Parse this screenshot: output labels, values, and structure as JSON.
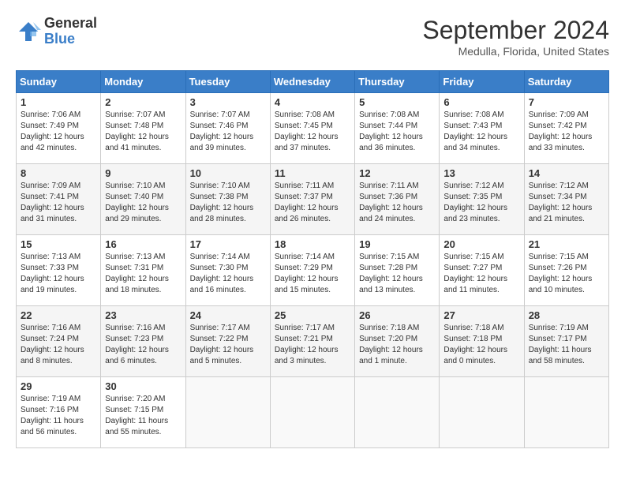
{
  "logo": {
    "general": "General",
    "blue": "Blue"
  },
  "title": "September 2024",
  "location": "Medulla, Florida, United States",
  "days_of_week": [
    "Sunday",
    "Monday",
    "Tuesday",
    "Wednesday",
    "Thursday",
    "Friday",
    "Saturday"
  ],
  "weeks": [
    [
      {
        "day": "1",
        "sunrise": "7:06 AM",
        "sunset": "7:49 PM",
        "daylight": "12 hours and 42 minutes."
      },
      {
        "day": "2",
        "sunrise": "7:07 AM",
        "sunset": "7:48 PM",
        "daylight": "12 hours and 41 minutes."
      },
      {
        "day": "3",
        "sunrise": "7:07 AM",
        "sunset": "7:46 PM",
        "daylight": "12 hours and 39 minutes."
      },
      {
        "day": "4",
        "sunrise": "7:08 AM",
        "sunset": "7:45 PM",
        "daylight": "12 hours and 37 minutes."
      },
      {
        "day": "5",
        "sunrise": "7:08 AM",
        "sunset": "7:44 PM",
        "daylight": "12 hours and 36 minutes."
      },
      {
        "day": "6",
        "sunrise": "7:08 AM",
        "sunset": "7:43 PM",
        "daylight": "12 hours and 34 minutes."
      },
      {
        "day": "7",
        "sunrise": "7:09 AM",
        "sunset": "7:42 PM",
        "daylight": "12 hours and 33 minutes."
      }
    ],
    [
      {
        "day": "8",
        "sunrise": "7:09 AM",
        "sunset": "7:41 PM",
        "daylight": "12 hours and 31 minutes."
      },
      {
        "day": "9",
        "sunrise": "7:10 AM",
        "sunset": "7:40 PM",
        "daylight": "12 hours and 29 minutes."
      },
      {
        "day": "10",
        "sunrise": "7:10 AM",
        "sunset": "7:38 PM",
        "daylight": "12 hours and 28 minutes."
      },
      {
        "day": "11",
        "sunrise": "7:11 AM",
        "sunset": "7:37 PM",
        "daylight": "12 hours and 26 minutes."
      },
      {
        "day": "12",
        "sunrise": "7:11 AM",
        "sunset": "7:36 PM",
        "daylight": "12 hours and 24 minutes."
      },
      {
        "day": "13",
        "sunrise": "7:12 AM",
        "sunset": "7:35 PM",
        "daylight": "12 hours and 23 minutes."
      },
      {
        "day": "14",
        "sunrise": "7:12 AM",
        "sunset": "7:34 PM",
        "daylight": "12 hours and 21 minutes."
      }
    ],
    [
      {
        "day": "15",
        "sunrise": "7:13 AM",
        "sunset": "7:33 PM",
        "daylight": "12 hours and 19 minutes."
      },
      {
        "day": "16",
        "sunrise": "7:13 AM",
        "sunset": "7:31 PM",
        "daylight": "12 hours and 18 minutes."
      },
      {
        "day": "17",
        "sunrise": "7:14 AM",
        "sunset": "7:30 PM",
        "daylight": "12 hours and 16 minutes."
      },
      {
        "day": "18",
        "sunrise": "7:14 AM",
        "sunset": "7:29 PM",
        "daylight": "12 hours and 15 minutes."
      },
      {
        "day": "19",
        "sunrise": "7:15 AM",
        "sunset": "7:28 PM",
        "daylight": "12 hours and 13 minutes."
      },
      {
        "day": "20",
        "sunrise": "7:15 AM",
        "sunset": "7:27 PM",
        "daylight": "12 hours and 11 minutes."
      },
      {
        "day": "21",
        "sunrise": "7:15 AM",
        "sunset": "7:26 PM",
        "daylight": "12 hours and 10 minutes."
      }
    ],
    [
      {
        "day": "22",
        "sunrise": "7:16 AM",
        "sunset": "7:24 PM",
        "daylight": "12 hours and 8 minutes."
      },
      {
        "day": "23",
        "sunrise": "7:16 AM",
        "sunset": "7:23 PM",
        "daylight": "12 hours and 6 minutes."
      },
      {
        "day": "24",
        "sunrise": "7:17 AM",
        "sunset": "7:22 PM",
        "daylight": "12 hours and 5 minutes."
      },
      {
        "day": "25",
        "sunrise": "7:17 AM",
        "sunset": "7:21 PM",
        "daylight": "12 hours and 3 minutes."
      },
      {
        "day": "26",
        "sunrise": "7:18 AM",
        "sunset": "7:20 PM",
        "daylight": "12 hours and 1 minute."
      },
      {
        "day": "27",
        "sunrise": "7:18 AM",
        "sunset": "7:18 PM",
        "daylight": "12 hours and 0 minutes."
      },
      {
        "day": "28",
        "sunrise": "7:19 AM",
        "sunset": "7:17 PM",
        "daylight": "11 hours and 58 minutes."
      }
    ],
    [
      {
        "day": "29",
        "sunrise": "7:19 AM",
        "sunset": "7:16 PM",
        "daylight": "11 hours and 56 minutes."
      },
      {
        "day": "30",
        "sunrise": "7:20 AM",
        "sunset": "7:15 PM",
        "daylight": "11 hours and 55 minutes."
      },
      null,
      null,
      null,
      null,
      null
    ]
  ]
}
